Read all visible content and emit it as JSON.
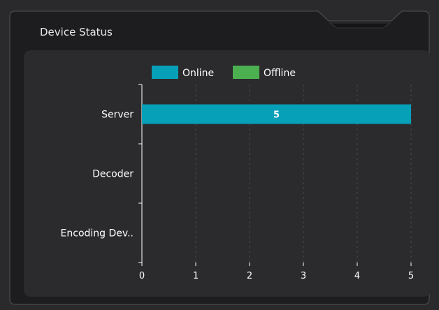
{
  "panel": {
    "title": "Device Status"
  },
  "colors": {
    "online": "#06a0b8",
    "offline": "#4caf50",
    "background": "#2a2a2c",
    "panel_fill": "#1d1d1f",
    "chart_fill": "#2b2b2d",
    "border": "#4a4a4c"
  },
  "chart_data": {
    "type": "bar",
    "orientation": "horizontal",
    "categories": [
      "Server",
      "Decoder",
      "Encoding Dev.."
    ],
    "series": [
      {
        "name": "Online",
        "values": [
          5,
          0,
          0
        ],
        "color": "#06a0b8"
      },
      {
        "name": "Offline",
        "values": [
          0,
          0,
          0
        ],
        "color": "#4caf50"
      }
    ],
    "data_labels": [
      "5",
      "",
      ""
    ],
    "x_ticks": [
      "0",
      "1",
      "2",
      "3",
      "4",
      "5"
    ],
    "xlim": [
      0,
      5
    ],
    "grid": "vertical dashed",
    "legend_position": "top-center",
    "stacked": true
  }
}
